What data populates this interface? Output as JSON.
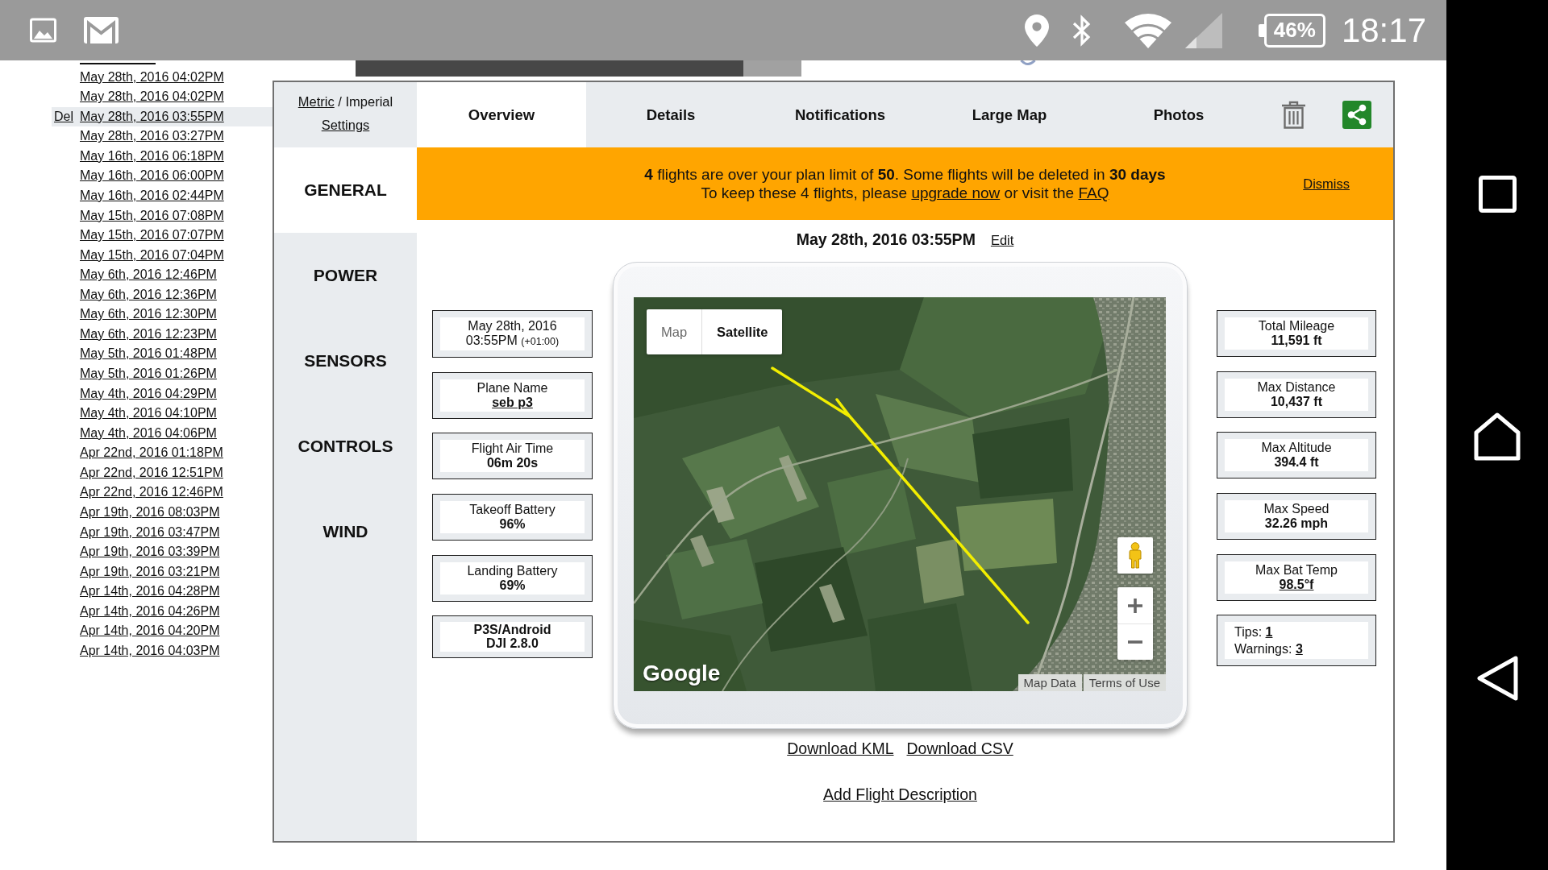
{
  "status_bar": {
    "battery": "46%",
    "time": "18:17"
  },
  "flight_list": {
    "delete_label": "Del",
    "items": [
      {
        "date": "May 28th, 2016 04:02PM",
        "selected": false
      },
      {
        "date": "May 28th, 2016 04:02PM",
        "selected": false
      },
      {
        "date": "May 28th, 2016 03:55PM",
        "selected": true
      },
      {
        "date": "May 28th, 2016 03:27PM",
        "selected": false
      },
      {
        "date": "May 16th, 2016 06:18PM",
        "selected": false
      },
      {
        "date": "May 16th, 2016 06:00PM",
        "selected": false
      },
      {
        "date": "May 16th, 2016 02:44PM",
        "selected": false
      },
      {
        "date": "May 15th, 2016 07:08PM",
        "selected": false
      },
      {
        "date": "May 15th, 2016 07:07PM",
        "selected": false
      },
      {
        "date": "May 15th, 2016 07:04PM",
        "selected": false
      },
      {
        "date": "May 6th, 2016 12:46PM",
        "selected": false
      },
      {
        "date": "May 6th, 2016 12:36PM",
        "selected": false
      },
      {
        "date": "May 6th, 2016 12:30PM",
        "selected": false
      },
      {
        "date": "May 6th, 2016 12:23PM",
        "selected": false
      },
      {
        "date": "May 5th, 2016 01:48PM",
        "selected": false
      },
      {
        "date": "May 5th, 2016 01:26PM",
        "selected": false
      },
      {
        "date": "May 4th, 2016 04:29PM",
        "selected": false
      },
      {
        "date": "May 4th, 2016 04:10PM",
        "selected": false
      },
      {
        "date": "May 4th, 2016 04:06PM",
        "selected": false
      },
      {
        "date": "Apr 22nd, 2016 01:18PM",
        "selected": false
      },
      {
        "date": "Apr 22nd, 2016 12:51PM",
        "selected": false
      },
      {
        "date": "Apr 22nd, 2016 12:46PM",
        "selected": false
      },
      {
        "date": "Apr 19th, 2016 08:03PM",
        "selected": false
      },
      {
        "date": "Apr 19th, 2016 03:47PM",
        "selected": false
      },
      {
        "date": "Apr 19th, 2016 03:39PM",
        "selected": false
      },
      {
        "date": "Apr 19th, 2016 03:21PM",
        "selected": false
      },
      {
        "date": "Apr 14th, 2016 04:28PM",
        "selected": false
      },
      {
        "date": "Apr 14th, 2016 04:26PM",
        "selected": false
      },
      {
        "date": "Apr 14th, 2016 04:20PM",
        "selected": false
      },
      {
        "date": "Apr 14th, 2016 04:03PM",
        "selected": false
      }
    ]
  },
  "panel": {
    "units": [
      {
        "label": "Metric",
        "selected": false
      },
      {
        "label": "Imperial",
        "selected": true
      }
    ],
    "unit_separator": "/",
    "settings_link": "Settings",
    "tabs": [
      {
        "label": "Overview",
        "selected": true
      },
      {
        "label": "Details",
        "selected": false
      },
      {
        "label": "Notifications",
        "selected": false
      },
      {
        "label": "Large Map",
        "selected": false
      },
      {
        "label": "Photos",
        "selected": false
      }
    ],
    "sections": [
      {
        "label": "GENERAL",
        "selected": true
      },
      {
        "label": "POWER",
        "selected": false
      },
      {
        "label": "SENSORS",
        "selected": false
      },
      {
        "label": "CONTROLS",
        "selected": false
      },
      {
        "label": "WIND",
        "selected": false
      }
    ],
    "alert": {
      "message": "**4** flights are over your plan limit of **50**. Some flights will be deleted in **30 days**",
      "detail": [
        {
          "kind": "text",
          "text": "To keep these 4 flights, please "
        },
        {
          "kind": "link",
          "text": "upgrade now"
        },
        {
          "kind": "text",
          "text": " or visit the "
        },
        {
          "kind": "link",
          "text": "FAQ"
        }
      ],
      "dismiss": "Dismiss"
    },
    "flight_title": "May 28th, 2016 03:55PM",
    "edit_link": "Edit",
    "left_cards": [
      {
        "kind": "datetime",
        "date": "May 28th, 2016",
        "time": "03:55PM",
        "offset": "(+01:00)"
      },
      {
        "kind": "stat",
        "label": "Plane Name",
        "value": "seb p3",
        "link": true
      },
      {
        "kind": "stat",
        "label": "Flight Air Time",
        "value": "06m 20s",
        "link": false
      },
      {
        "kind": "stat",
        "label": "Takeoff Battery",
        "value": "96%",
        "link": false
      },
      {
        "kind": "stat",
        "label": "Landing Battery",
        "value": "69%",
        "link": false
      },
      {
        "kind": "device",
        "lines": [
          "P3S/Android",
          "DJI 2.8.0"
        ]
      }
    ],
    "right_cards": [
      {
        "kind": "stat",
        "label": "Total Mileage",
        "value": "11,591 ft",
        "link": false
      },
      {
        "kind": "stat",
        "label": "Max Distance",
        "value": "10,437 ft",
        "link": false
      },
      {
        "kind": "stat",
        "label": "Max Altitude",
        "value": "394.4 ft",
        "link": false
      },
      {
        "kind": "stat",
        "label": "Max Speed",
        "value": "32.26 mph",
        "link": false
      },
      {
        "kind": "stat",
        "label": "Max Bat Temp",
        "value": "98.5°f",
        "link": true
      },
      {
        "kind": "counts",
        "rows": [
          {
            "label": "Tips:",
            "value": "1"
          },
          {
            "label": "Warnings:",
            "value": "3"
          }
        ]
      }
    ],
    "map": {
      "type_buttons": [
        {
          "label": "Map",
          "selected": false
        },
        {
          "label": "Satellite",
          "selected": true
        }
      ],
      "logo": "Google",
      "footer_links": [
        "Map Data",
        "Terms of Use"
      ]
    },
    "downloads": [
      "Download KML",
      "Download CSV"
    ],
    "add_description": "Add Flight Description"
  }
}
